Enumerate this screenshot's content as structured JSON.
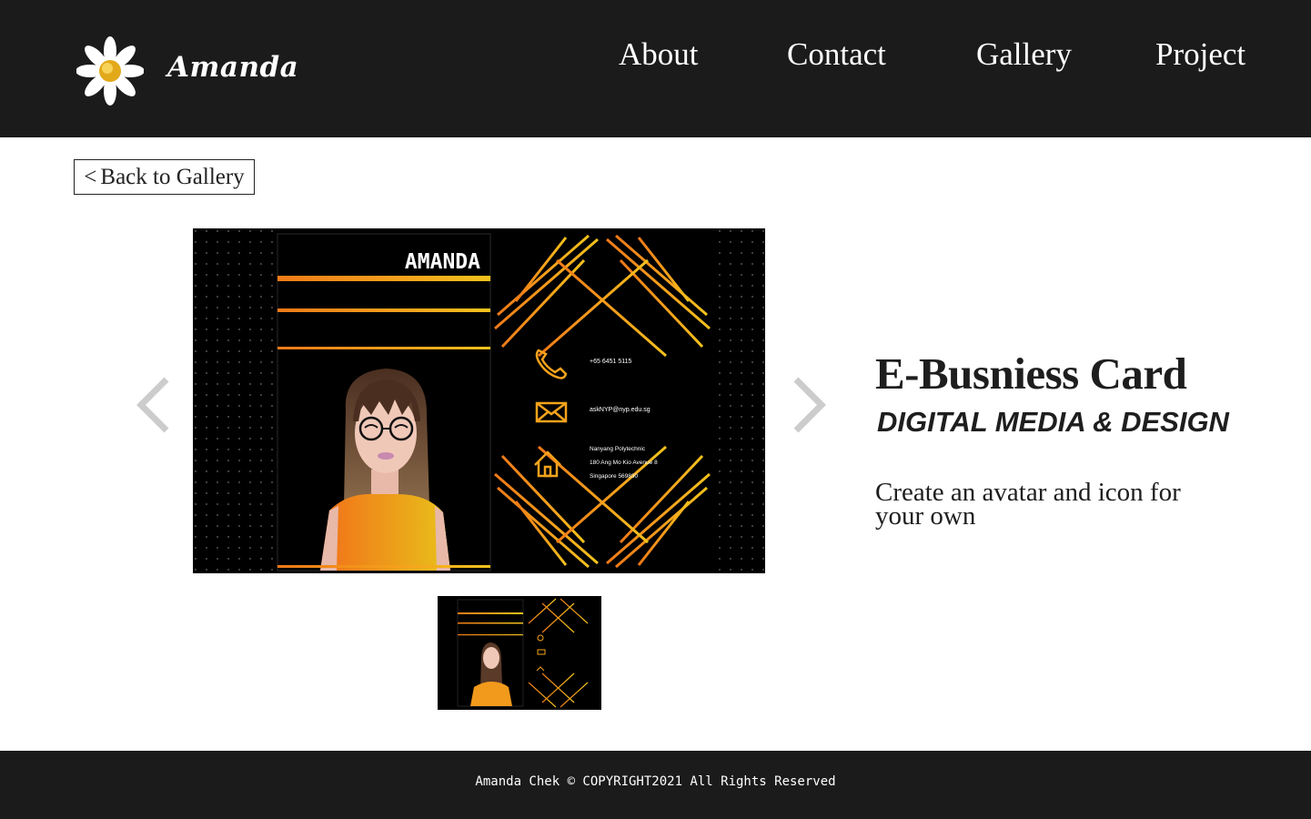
{
  "header": {
    "brand": "Amanda",
    "nav": [
      "About",
      "Contact",
      "Gallery",
      "Project"
    ]
  },
  "back_button": {
    "chevron": "<",
    "label": "Back to Gallery"
  },
  "project": {
    "title": "E-Busniess Card",
    "subtitle": "DIGITAL MEDIA & DESIGN",
    "description": "Create an avatar and icon for your own"
  },
  "card": {
    "name": "AMANDA",
    "phone": "+65 6451 5115",
    "email": "askNYP@nyp.edu.sg",
    "address_line1": "Nanyang Polytechnic",
    "address_line2": "180 Ang Mo Kio Avenue 8",
    "address_line3": "Singapore 569830"
  },
  "icons": {
    "logo": "daisy-flower-icon",
    "prev": "chevron-left-icon",
    "next": "chevron-right-icon",
    "phone": "phone-icon",
    "mail": "mail-icon",
    "home": "home-icon"
  },
  "colors": {
    "header_bg": "#1c1b1b",
    "accent_orange": "#f28a1c",
    "accent_yellow": "#f5c518",
    "arrow_gray": "#cccccc"
  },
  "footer": {
    "copyright": "Amanda Chek © COPYRIGHT2021 All Rights Reserved"
  }
}
